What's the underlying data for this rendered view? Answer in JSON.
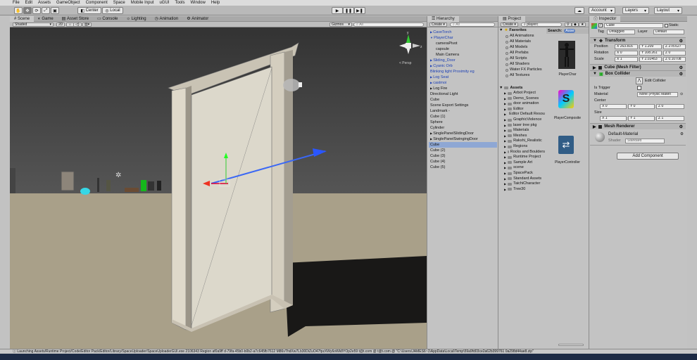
{
  "menu": [
    "File",
    "Edit",
    "Assets",
    "GameObject",
    "Component",
    "Space",
    "Mobile Input",
    "uGUI",
    "Tools",
    "Window",
    "Help"
  ],
  "toolbar": {
    "pivot_label": "Center",
    "space_label": "Local",
    "account_label": "Account",
    "layers_label": "Layers",
    "layout_label": "Layout"
  },
  "scene_tabs": [
    "Scene",
    "Game",
    "Asset Store",
    "Console",
    "Lighting",
    "Animation",
    "Animator"
  ],
  "scene_bar": {
    "shading": "Shaded",
    "mode": "2D",
    "gizmos": "Gizmos",
    "search": "All"
  },
  "gizmo_label": "< Persp",
  "hierarchy": {
    "tab": "Hierarchy",
    "create": "Create",
    "search": "All",
    "items": [
      {
        "label": "CaveTorch",
        "blue": true,
        "indent": 0,
        "arrow": "▶"
      },
      {
        "label": "PlayerChar",
        "blue": true,
        "indent": 0,
        "arrow": "▼"
      },
      {
        "label": "cameraPivot",
        "blue": false,
        "indent": 2,
        "arrow": ""
      },
      {
        "label": "capsule",
        "blue": false,
        "indent": 2,
        "arrow": ""
      },
      {
        "label": "Main Camera",
        "blue": false,
        "indent": 2,
        "arrow": ""
      },
      {
        "label": "Sliding_Door",
        "blue": true,
        "indent": 0,
        "arrow": "▶"
      },
      {
        "label": "Cyanic Orb",
        "blue": true,
        "indent": 0,
        "arrow": "▶"
      },
      {
        "label": "Blinking light Proximity eg",
        "blue": true,
        "indent": 0,
        "arrow": ""
      },
      {
        "label": "Log Seat",
        "blue": true,
        "indent": 0,
        "arrow": "▶"
      },
      {
        "label": "castmoi",
        "blue": true,
        "indent": 0,
        "arrow": "▶"
      },
      {
        "label": "Log Fire",
        "blue": false,
        "indent": 0,
        "arrow": "▶"
      },
      {
        "label": "Directional Light",
        "blue": false,
        "indent": 0,
        "arrow": ""
      },
      {
        "label": "Cube",
        "blue": false,
        "indent": 0,
        "arrow": ""
      },
      {
        "label": "Scene Export Settings",
        "blue": false,
        "indent": 0,
        "arrow": ""
      },
      {
        "label": "Landmark -",
        "blue": false,
        "indent": 0,
        "arrow": ""
      },
      {
        "label": "Cube (1)",
        "blue": false,
        "indent": 0,
        "arrow": ""
      },
      {
        "label": "Sphere",
        "blue": false,
        "indent": 0,
        "arrow": ""
      },
      {
        "label": "Cylinder",
        "blue": false,
        "indent": 0,
        "arrow": ""
      },
      {
        "label": "SinglePanelSlidingDoor",
        "blue": false,
        "indent": 0,
        "arrow": "▶"
      },
      {
        "label": "SinglePanelSwingingDoor",
        "blue": false,
        "indent": 0,
        "arrow": "▶"
      },
      {
        "label": "Cube",
        "blue": false,
        "indent": 0,
        "arrow": "",
        "selected": true
      },
      {
        "label": "Cube (2)",
        "blue": false,
        "indent": 0,
        "arrow": ""
      },
      {
        "label": "Cube (3)",
        "blue": false,
        "indent": 0,
        "arrow": ""
      },
      {
        "label": "Cube (4)",
        "blue": false,
        "indent": 0,
        "arrow": ""
      },
      {
        "label": "Cube (5)",
        "blue": false,
        "indent": 0,
        "arrow": ""
      }
    ]
  },
  "project": {
    "tab": "Project",
    "create": "Create",
    "search": "playerc",
    "favorites_label": "Favorites",
    "favorites": [
      "All Animations",
      "All Materials",
      "All Models",
      "All Prefabs",
      "All Scripts",
      "All Shaders",
      "Water FX Particles",
      "All Textures"
    ],
    "assets_label": "Assets",
    "assets": [
      "Arbot Project",
      "Demo_Scenes",
      "door animation",
      "Editor",
      "Editor Default Resources",
      "GraphicViolence",
      "laser tree pkg",
      "Materials",
      "Meshes",
      "Rakshi_Realistic",
      "Regions",
      "Rocks and Boulders",
      "Runtime Project",
      "Sample Art",
      "scene",
      "SpacePack",
      "Standard Assets",
      "TaichiCharacter",
      "Tree30"
    ],
    "search_header": "Search:",
    "search_scope": "Asse",
    "results": [
      "PlayerChar",
      "PlayerComposite",
      "PlayerController"
    ]
  },
  "inspector": {
    "tab": "Inspector",
    "object_name": "Cube",
    "static_label": "Static",
    "tag_label": "Tag",
    "tag_value": "Untagged",
    "layer_label": "Layer",
    "layer_value": "Default",
    "transform": {
      "title": "Transform",
      "position_label": "Position",
      "rotation_label": "Rotation",
      "scale_label": "Scale",
      "position": [
        "X 263.816",
        "Y 1.209",
        "Z 278.627"
      ],
      "rotation": [
        "X 0",
        "Y 108.261",
        "Z 0"
      ],
      "scale": [
        "X 1",
        "Y 2.02453",
        "Z 0.10708"
      ]
    },
    "box_collider": {
      "title": "Box Collider",
      "edit_label": "Edit Collider",
      "is_trigger_label": "Is Trigger",
      "material_label": "Material",
      "material_value": "None (Physic Materi",
      "center_label": "Center",
      "center": [
        "X 0",
        "Y 0",
        "Z 0"
      ],
      "size_label": "Size",
      "size": [
        "X 1",
        "Y 1",
        "Z 1"
      ]
    },
    "mesh_filter_title": "Cube (Mesh Filter)",
    "mesh_renderer_title": "Mesh Renderer",
    "material_name": "Default-Material",
    "shader_label": "Shader",
    "shader_value": "Standard",
    "add_component": "Add Component"
  },
  "status_text": "Launching Assets/Runtime Project/Code/Editor Pack/Editor/Library/SpaceUploader/SpaceUploaderGUI.exe 2106343 Region af0a9ff d-79fa-45b0-b0b2-a7c645fb7612 M86vThdXw7Lb30DiZuO47fpzXWy6oWk8YOp2e59 t@t.com @ t@t.com @ \"C:\\Users\\JAMES6~1\\AppData\\Local\\Temp\\59a9fd03ce2a62b399761 0a298d44ae8.zip\"",
  "colors": {
    "sky": "#363636",
    "ground": "#a9a089",
    "door_frame": "#d9d3c4",
    "door_panel": "#dad7cc",
    "accent_blue": "#1b3fb5"
  }
}
